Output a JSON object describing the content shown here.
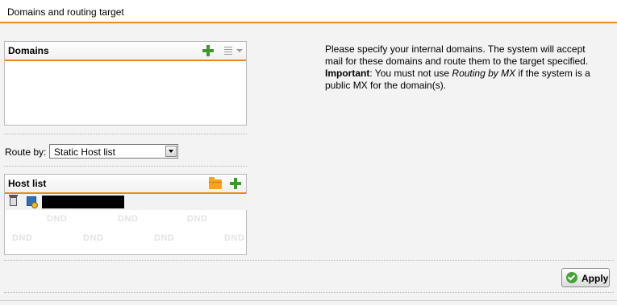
{
  "header": {
    "title": "Domains and routing target"
  },
  "domains_box": {
    "title": "Domains",
    "add_icon": "plus-icon",
    "list_icon": "list-icon"
  },
  "route": {
    "label": "Route by:",
    "selected": "Static Host list"
  },
  "host_list_box": {
    "title": "Host list",
    "folder_icon": "folder-icon",
    "add_icon": "plus-icon",
    "rows": [
      {
        "host": ""
      }
    ],
    "dnd_watermark": "DND"
  },
  "info": {
    "line1": "Please specify your internal domains. The system will accept mail for these domains and route them to the target specified.",
    "important_label": "Important",
    "important_text_1": ": You must not use ",
    "routing_by_mx": "Routing by MX",
    "important_text_2": " if the system is a public MX for the domain(s)."
  },
  "apply": {
    "label": "Apply"
  },
  "colors": {
    "accent": "#e68a1e",
    "add_green": "#3c9a2a",
    "background": "#f3f3f3"
  }
}
